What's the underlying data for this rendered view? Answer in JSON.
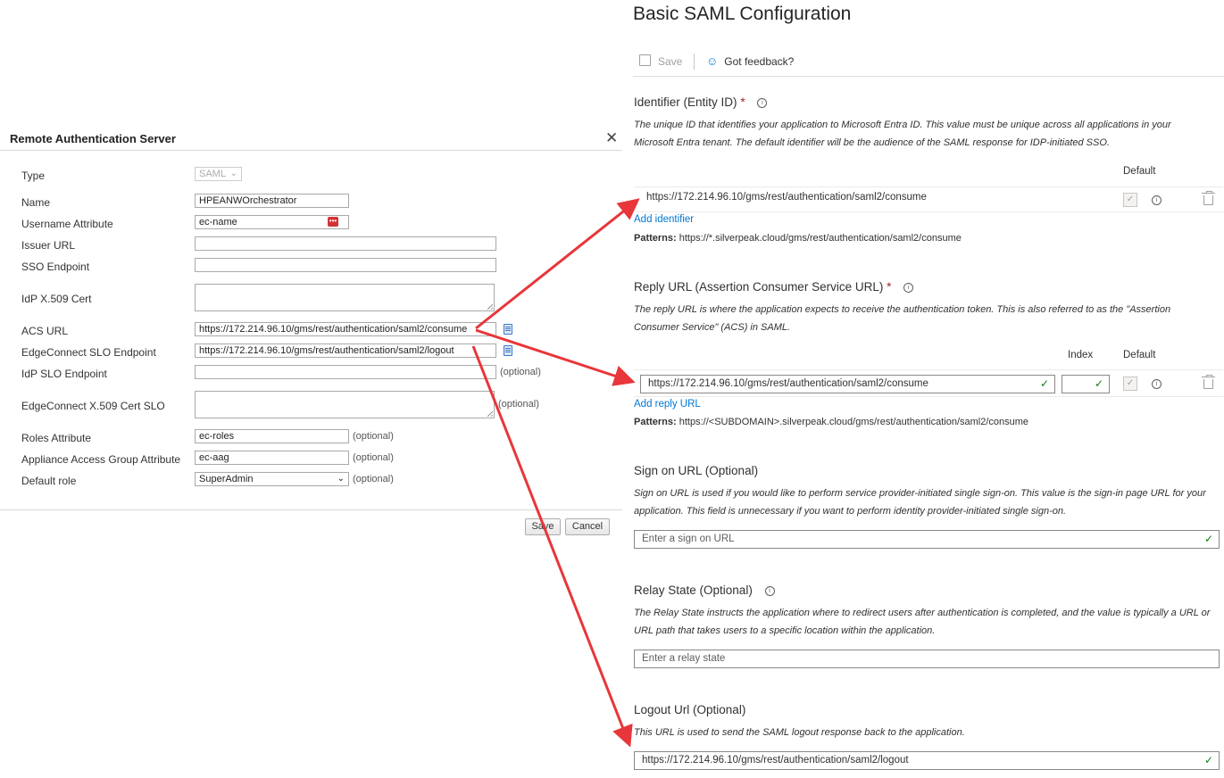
{
  "dialog": {
    "title": "Remote Authentication Server",
    "close_glyph": "✕",
    "fields": {
      "type": {
        "label": "Type",
        "value": "SAML"
      },
      "name": {
        "label": "Name",
        "value": "HPEANWOrchestrator"
      },
      "username_attribute": {
        "label": "Username Attribute",
        "value": "ec-name"
      },
      "issuer_url": {
        "label": "Issuer URL",
        "value": ""
      },
      "sso_endpoint": {
        "label": "SSO Endpoint",
        "value": ""
      },
      "idp_cert": {
        "label": "IdP X.509 Cert",
        "value": ""
      },
      "acs_url": {
        "label": "ACS URL",
        "value": "https://172.214.96.10/gms/rest/authentication/saml2/consume"
      },
      "ec_slo_endpoint": {
        "label": "EdgeConnect SLO Endpoint",
        "value": "https://172.214.96.10/gms/rest/authentication/saml2/logout"
      },
      "idp_slo_endpoint": {
        "label": "IdP SLO Endpoint",
        "value": "",
        "note": "(optional)"
      },
      "ec_cert_slo": {
        "label": "EdgeConnect X.509 Cert SLO",
        "value": "",
        "note": "(optional)"
      },
      "roles_attribute": {
        "label": "Roles Attribute",
        "value": "ec-roles",
        "note": "(optional)"
      },
      "appliance_group_attribute": {
        "label": "Appliance Access Group Attribute",
        "value": "ec-aag",
        "note": "(optional)"
      },
      "default_role": {
        "label": "Default role",
        "value": "SuperAdmin",
        "note": "(optional)"
      }
    },
    "buttons": {
      "save": "Save",
      "cancel": "Cancel"
    }
  },
  "saml": {
    "title": "Basic SAML Configuration",
    "toolbar": {
      "save": "Save",
      "feedback": "Got feedback?"
    },
    "identifier": {
      "title": "Identifier (Entity ID)",
      "required": "*",
      "description": "The unique ID that identifies your application to Microsoft Entra ID. This value must be unique across all applications in your Microsoft Entra tenant. The default identifier will be the audience of the SAML response for IDP-initiated SSO.",
      "col_default": "Default",
      "value": "https://172.214.96.10/gms/rest/authentication/saml2/consume",
      "add_link": "Add identifier",
      "patterns_label": "Patterns:",
      "patterns_value": "https://*.silverpeak.cloud/gms/rest/authentication/saml2/consume"
    },
    "reply": {
      "title": "Reply URL (Assertion Consumer Service URL)",
      "required": "*",
      "description": "The reply URL is where the application expects to receive the authentication token. This is also referred to as the \"Assertion Consumer Service\" (ACS) in SAML.",
      "col_index": "Index",
      "col_default": "Default",
      "value": "https://172.214.96.10/gms/rest/authentication/saml2/consume",
      "add_link": "Add reply URL",
      "patterns_label": "Patterns:",
      "patterns_value": "https://<SUBDOMAIN>.silverpeak.cloud/gms/rest/authentication/saml2/consume"
    },
    "sign_on": {
      "title": "Sign on URL (Optional)",
      "description": "Sign on URL is used if you would like to perform service provider-initiated single sign-on. This value is the sign-in page URL for your application. This field is unnecessary if you want to perform identity provider-initiated single sign-on.",
      "placeholder": "Enter a sign on URL"
    },
    "relay": {
      "title": "Relay State (Optional)",
      "description": "The Relay State instructs the application where to redirect users after authentication is completed, and the value is typically a URL or URL path that takes users to a specific location within the application.",
      "placeholder": "Enter a relay state"
    },
    "logout": {
      "title": "Logout Url (Optional)",
      "description": "This URL is used to send the SAML logout response back to the application.",
      "value": "https://172.214.96.10/gms/rest/authentication/saml2/logout"
    }
  },
  "colors": {
    "arrow": "#e8363a",
    "link": "#0078d4",
    "ok": "#107c10",
    "required": "#a4262c"
  }
}
